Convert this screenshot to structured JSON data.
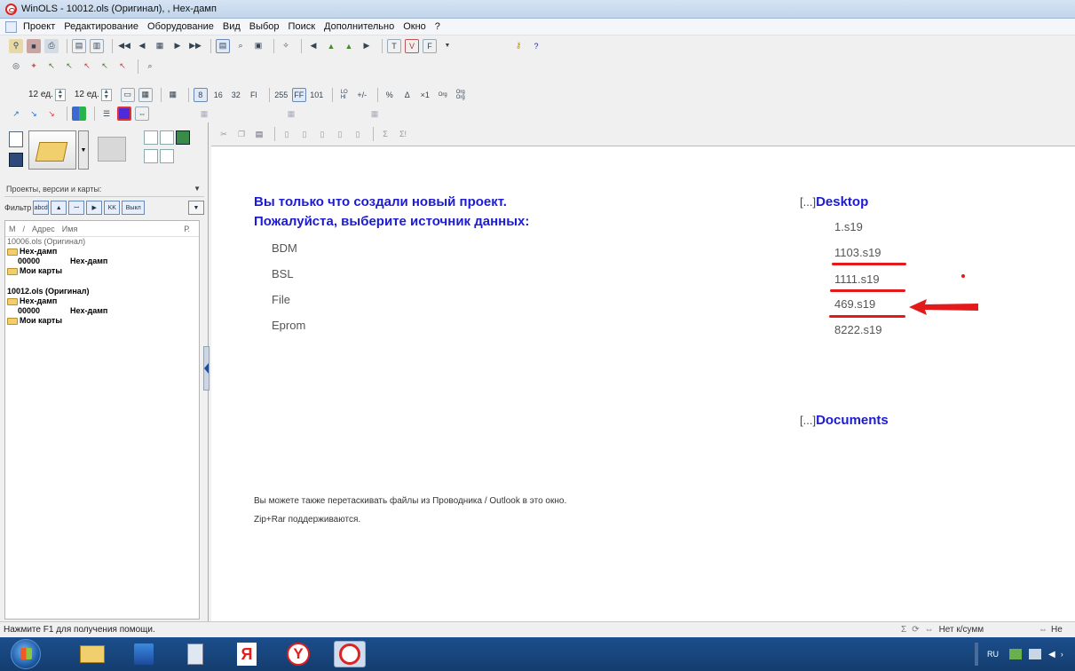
{
  "window": {
    "title": "WinOLS - 10012.ols (Оригинал), , Hex-дамп"
  },
  "menu": {
    "items": [
      "Проект",
      "Редактирование",
      "Оборудование",
      "Вид",
      "Выбор",
      "Поиск",
      "Дополнительно",
      "Окно",
      "?"
    ]
  },
  "toolbar3": {
    "unit1": "12 ед.",
    "unit2": "12 ед."
  },
  "left_panel": {
    "dropdown_label": "Проекты, версии и карты:",
    "filter_label": "Фильтр",
    "filter_buttons": [
      "abcd",
      "▲",
      "ꟷ",
      "▶",
      "KK",
      "Выкл"
    ],
    "tree_headers": [
      "М",
      "/",
      "Адрес",
      "Имя",
      "Р."
    ],
    "tree": [
      {
        "text": "10006.ols (Оригинал)",
        "style": "gray",
        "indent": 0
      },
      {
        "text": "Hex-дамп",
        "style": "bold",
        "indent": 0,
        "folder": true
      },
      {
        "text": "00000",
        "text2": "Hex-дамп",
        "style": "bold",
        "indent": 12
      },
      {
        "text": "Мои карты",
        "style": "bold",
        "indent": 0,
        "folder": true
      },
      {
        "text": "",
        "indent": 0
      },
      {
        "text": "10012.ols (Оригинал)",
        "style": "bold",
        "indent": 0
      },
      {
        "text": "Hex-дамп",
        "style": "bold",
        "indent": 0,
        "folder": true
      },
      {
        "text": "00000",
        "text2": "Hex-дамп",
        "style": "bold",
        "indent": 12
      },
      {
        "text": "Мои карты",
        "style": "bold",
        "indent": 0,
        "folder": true
      }
    ]
  },
  "main": {
    "heading_line1": "Вы только что создали новый проект.",
    "heading_line2": "Пожалуйста, выберите источник данных:",
    "sources": [
      "BDM",
      "BSL",
      "File",
      "Eprom"
    ],
    "hint_line1": "Вы можете также перетаскивать файлы из Проводника / Outlook в это окно.",
    "hint_line2": "Zip+Rar поддерживаются.",
    "desktop": {
      "bracket": "[...]",
      "label": "Desktop",
      "files": [
        "1.s19",
        "1103.s19",
        "1111.s19",
        "469.s19",
        "8222.s19"
      ]
    },
    "documents": {
      "bracket": "[...]",
      "label": "Documents"
    },
    "annotation_color": "#e41919"
  },
  "status": {
    "help": "Нажмите F1 для получения помощи.",
    "checksum": "Нет к/сумм",
    "right_cut": "Не"
  },
  "taskbar": {
    "lang": "RU"
  }
}
